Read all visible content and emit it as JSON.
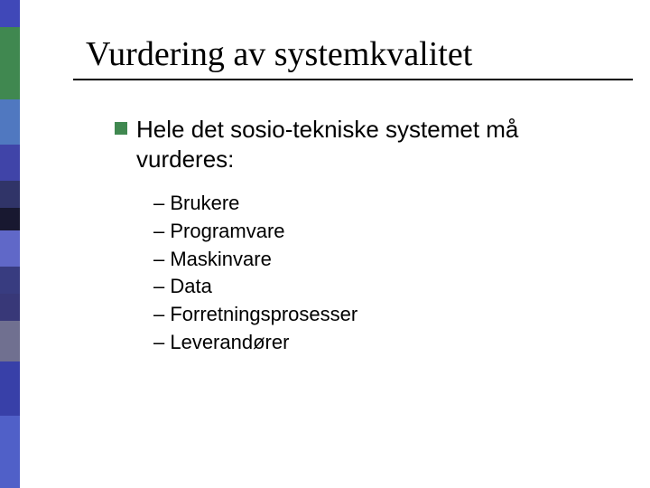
{
  "title": "Vurdering av systemkvalitet",
  "main_bullet": "Hele det sosio-tekniske systemet må vurderes:",
  "sub_items": [
    "– Brukere",
    "– Programvare",
    "– Maskinvare",
    "– Data",
    "– Forretningsprosesser",
    "– Leverandører"
  ]
}
